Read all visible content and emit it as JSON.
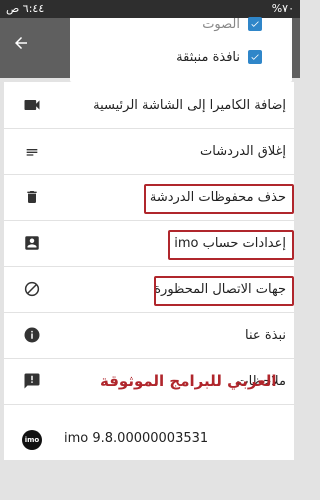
{
  "status": {
    "time": "٦:٤٤ ص",
    "battery": "%٧٠",
    "signal_icons": "signal-wifi"
  },
  "appbar": {
    "back_icon": "arrow-back-icon"
  },
  "dialog": {
    "partial_top_label": "الصوت",
    "floating_window_label": "نافذة منبثقة",
    "floating_checked": true
  },
  "menu": [
    {
      "label": "إضافة الكاميرا إلى الشاشة الرئيسية",
      "icon": "video-camera-icon"
    },
    {
      "label": "إغلاق الدردشات",
      "icon": "short-text-icon"
    },
    {
      "label": "حذف محفوظات الدردشة",
      "icon": "trash-icon"
    },
    {
      "label": "إعدادات حساب imo",
      "icon": "account-box-icon"
    },
    {
      "label": "جهات الاتصال المحظورة",
      "icon": "block-icon"
    },
    {
      "label": "نبذة عنا",
      "icon": "info-icon"
    },
    {
      "label": "ملاحظات",
      "icon": "feedback-icon"
    }
  ],
  "version": {
    "label": "imo 9.8.00000003531",
    "icon": "imo-logo-icon"
  },
  "watermark": "العربي للبرامج الموثوقة",
  "colors": {
    "appbar": "#5f5f5f",
    "checkbox": "#2f86c9",
    "highlight": "#b0262c"
  }
}
